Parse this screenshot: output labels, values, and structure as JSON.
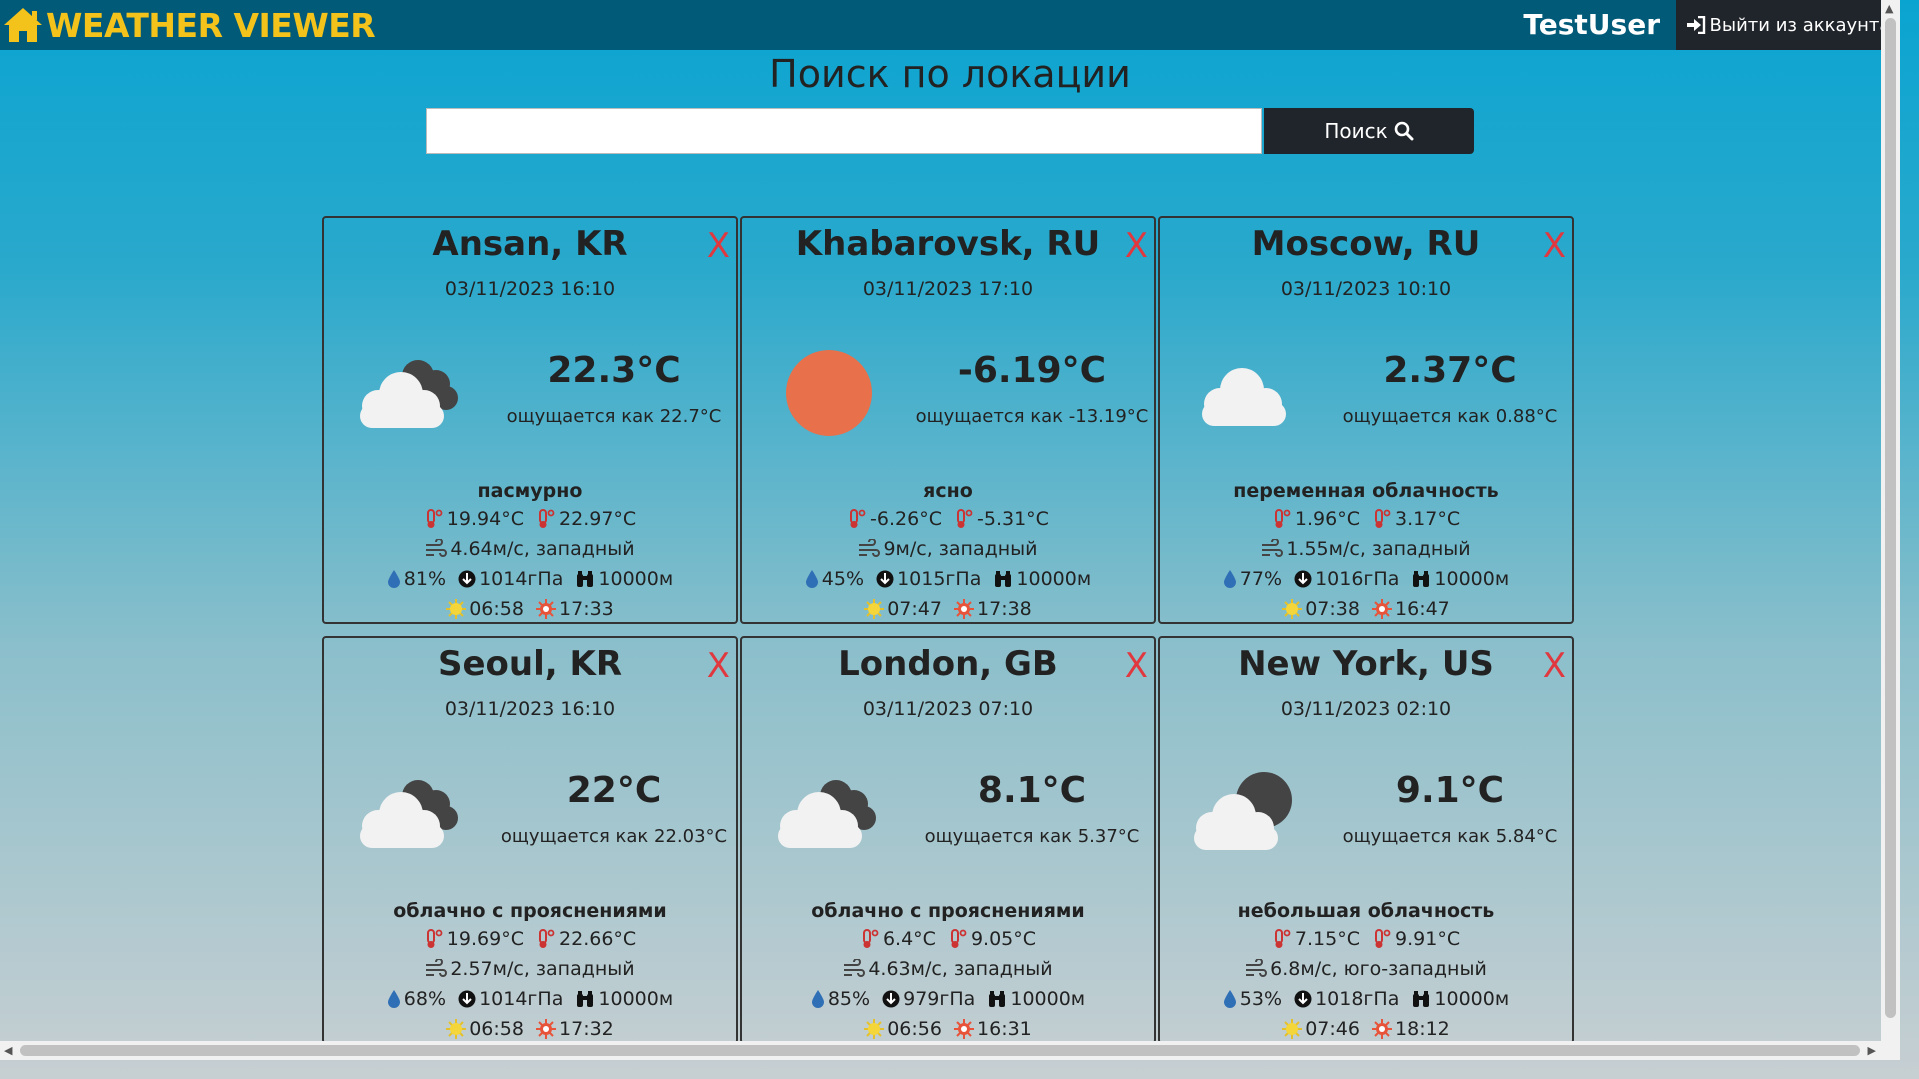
{
  "navbar": {
    "brand": "WEATHER VIEWER",
    "username": "TestUser",
    "logout_label": "Выйти из аккаунта"
  },
  "search": {
    "title": "Поиск по локации",
    "placeholder": "",
    "button_label": "Поиск"
  },
  "colors": {
    "navbar": "#015a78",
    "brand": "#f3c21b",
    "close": "#e0383e",
    "sun": "#e8704a"
  },
  "cards": [
    {
      "city": "Ansan, KR",
      "datetime": "03/11/2023 16:10",
      "icon": "broken-clouds-icon",
      "temp": "22.3°C",
      "feels": "ощущается как 22.7°C",
      "desc": "пасмурно",
      "tmin": "19.94°C",
      "tmax": "22.97°C",
      "wind": "4.64м/с, западный",
      "humidity": "81%",
      "pressure": "1014гПа",
      "visibility": "10000м",
      "sunrise": "06:58",
      "sunset": "17:33"
    },
    {
      "city": "Khabarovsk, RU",
      "datetime": "03/11/2023 17:10",
      "icon": "clear-sky-icon",
      "temp": "-6.19°C",
      "feels": "ощущается как -13.19°C",
      "desc": "ясно",
      "tmin": "-6.26°C",
      "tmax": "-5.31°C",
      "wind": "9м/с, западный",
      "humidity": "45%",
      "pressure": "1015гПа",
      "visibility": "10000м",
      "sunrise": "07:47",
      "sunset": "17:38"
    },
    {
      "city": "Moscow, RU",
      "datetime": "03/11/2023 10:10",
      "icon": "scattered-clouds-icon",
      "temp": "2.37°C",
      "feels": "ощущается как 0.88°C",
      "desc": "переменная облачность",
      "tmin": "1.96°C",
      "tmax": "3.17°C",
      "wind": "1.55м/с, западный",
      "humidity": "77%",
      "pressure": "1016гПа",
      "visibility": "10000м",
      "sunrise": "07:38",
      "sunset": "16:47"
    },
    {
      "city": "Seoul, KR",
      "datetime": "03/11/2023 16:10",
      "icon": "broken-clouds-icon",
      "temp": "22°C",
      "feels": "ощущается как 22.03°C",
      "desc": "облачно с прояснениями",
      "tmin": "19.69°C",
      "tmax": "22.66°C",
      "wind": "2.57м/с, западный",
      "humidity": "68%",
      "pressure": "1014гПа",
      "visibility": "10000м",
      "sunrise": "06:58",
      "sunset": "17:32"
    },
    {
      "city": "London, GB",
      "datetime": "03/11/2023 07:10",
      "icon": "broken-clouds-icon",
      "temp": "8.1°C",
      "feels": "ощущается как 5.37°C",
      "desc": "облачно с прояснениями",
      "tmin": "6.4°C",
      "tmax": "9.05°C",
      "wind": "4.63м/с, западный",
      "humidity": "85%",
      "pressure": "979гПа",
      "visibility": "10000м",
      "sunrise": "06:56",
      "sunset": "16:31"
    },
    {
      "city": "New York, US",
      "datetime": "03/11/2023 02:10",
      "icon": "few-clouds-night-icon",
      "temp": "9.1°C",
      "feels": "ощущается как 5.84°C",
      "desc": "небольшая облачность",
      "tmin": "7.15°C",
      "tmax": "9.91°C",
      "wind": "6.8м/с, юго-западный",
      "humidity": "53%",
      "pressure": "1018гПа",
      "visibility": "10000м",
      "sunrise": "07:46",
      "sunset": "18:12"
    }
  ]
}
